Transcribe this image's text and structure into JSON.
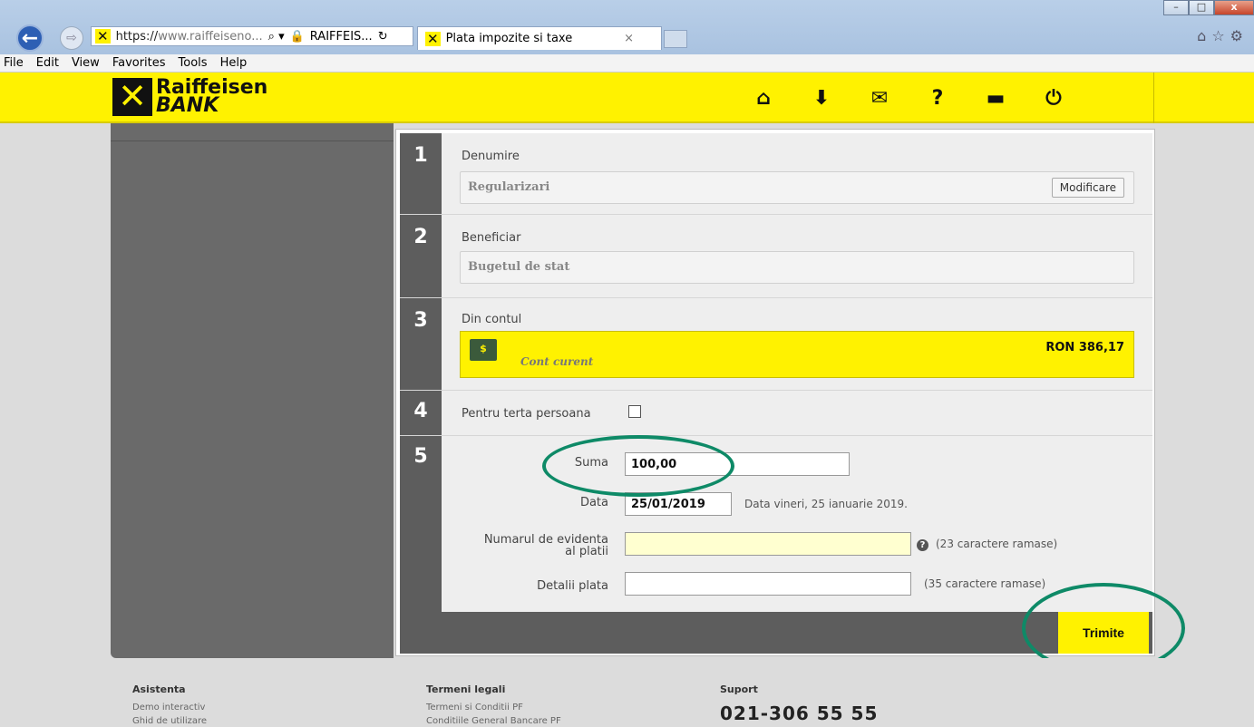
{
  "browser": {
    "url_host_part": "https://www.raiffeiseno...",
    "url_host": "https://",
    "url_domain": "www.raiffeiseno...",
    "address_extra": "RAIFFEIS...",
    "tab_title": "Plata impozite si taxe",
    "tab_close": "×",
    "menu": [
      "File",
      "Edit",
      "View",
      "Favorites",
      "Tools",
      "Help"
    ]
  },
  "header": {
    "logo_line1": "Raiffeisen",
    "logo_line2": "BANK",
    "icons": [
      "home-icon",
      "download-icon",
      "mail-icon",
      "help-icon",
      "print-icon",
      "power-icon"
    ]
  },
  "form": {
    "step1": {
      "number": "1",
      "label": "Denumire",
      "value": "Regularizari",
      "button": "Modificare"
    },
    "step2": {
      "number": "2",
      "label": "Beneficiar",
      "value": "Bugetul de stat"
    },
    "step3": {
      "number": "3",
      "label": "Din contul",
      "account_name": "Cont curent",
      "balance": "RON 386,17",
      "icon_text": "$"
    },
    "step4": {
      "number": "4",
      "label": "Pentru terta persoana"
    },
    "step5": {
      "number": "5",
      "suma_label": "Suma",
      "suma_value": "100,00",
      "data_label": "Data",
      "data_value": "25/01/2019",
      "data_hint": "Data vineri, 25 ianuarie 2019.",
      "numar_label_1": "Numarul de evidenta",
      "numar_label_2": "al platii",
      "numar_hint": "(23 caractere ramase)",
      "detalii_label": "Detalii plata",
      "detalii_hint": "(35 caractere ramase)"
    },
    "submit": "Trimite"
  },
  "footer": {
    "asistenta": {
      "title": "Asistenta",
      "items": [
        "Demo interactiv",
        "Ghid de utilizare"
      ]
    },
    "termeni": {
      "title": "Termeni legali",
      "items": [
        "Termeni si Conditii PF",
        "Conditiile General Bancare PF"
      ]
    },
    "suport": {
      "title": "Suport",
      "phone": "021-306 55 55"
    }
  },
  "colors": {
    "brand_yellow": "#fff200",
    "annotation_green": "#0e8a67",
    "step_gray": "#5d5d5d"
  }
}
